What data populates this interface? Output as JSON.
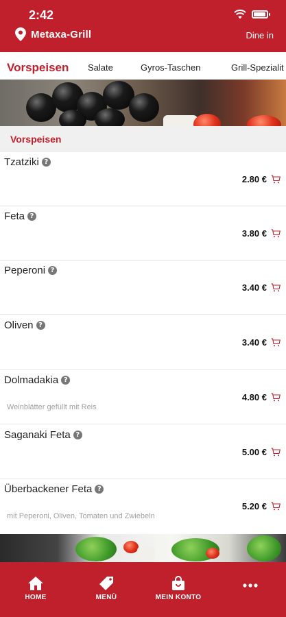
{
  "status_bar": {
    "time": "2:42"
  },
  "header": {
    "restaurant_name": "Metaxa-Grill",
    "mode": "Dine in"
  },
  "tabs": [
    {
      "label": "Vorspeisen",
      "active": true
    },
    {
      "label": "Salate",
      "active": false
    },
    {
      "label": "Gyros-Taschen",
      "active": false
    },
    {
      "label": "Grill-Spezialit",
      "active": false
    }
  ],
  "section": {
    "title": "Vorspeisen"
  },
  "items": [
    {
      "name": "Tzatziki",
      "description": "",
      "price": "2.80 €"
    },
    {
      "name": "Feta",
      "description": "",
      "price": "3.80 €"
    },
    {
      "name": "Peperoni",
      "description": "",
      "price": "3.40 €"
    },
    {
      "name": "Oliven",
      "description": "",
      "price": "3.40 €"
    },
    {
      "name": "Dolmadakia",
      "description": "Weinblätter gefüllt mit Reis",
      "price": "4.80 €"
    },
    {
      "name": "Saganaki Feta",
      "description": "",
      "price": "5.00 €"
    },
    {
      "name": "Überbackener Feta",
      "description": "mit Peperoni, Oliven, Tomaten und Zwiebeln",
      "price": "5.20 €"
    }
  ],
  "info_icon_glyph": "?",
  "bottom_nav": [
    {
      "label": "HOME",
      "icon": "home-icon"
    },
    {
      "label": "MENÜ",
      "icon": "tag-icon"
    },
    {
      "label": "MEIN KONTO",
      "icon": "shopping-bag-icon"
    },
    {
      "label": "",
      "icon": "more-dots-icon"
    }
  ],
  "colors": {
    "brand_red": "#c0202b",
    "section_bg": "#f0f0f0",
    "desc_gray": "#a0a0a0"
  }
}
